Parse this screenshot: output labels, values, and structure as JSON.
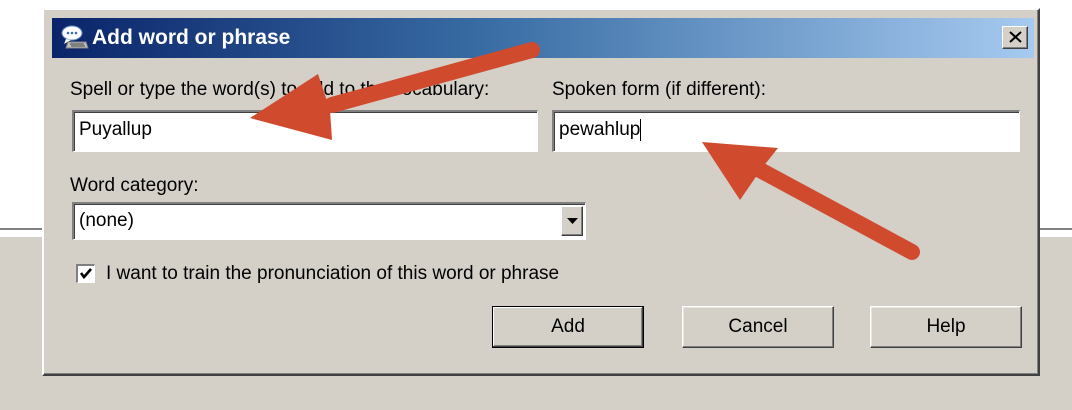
{
  "dialog": {
    "title": "Add word or phrase",
    "close_icon": "close-icon",
    "title_icon": "speech-dictation-icon"
  },
  "fields": {
    "word_label": "Spell or type the word(s) to add to the vocabulary:",
    "word_value": "Puyallup",
    "spoken_label": "Spoken form (if different):",
    "spoken_value": "pewahlup",
    "category_label": "Word category:",
    "category_value": "(none)"
  },
  "train_checkbox": {
    "label": "I want to train the pronunciation of this word or phrase",
    "checked": true
  },
  "buttons": {
    "add": "Add",
    "cancel": "Cancel",
    "help": "Help"
  },
  "annotation_color": "#d04a2e"
}
